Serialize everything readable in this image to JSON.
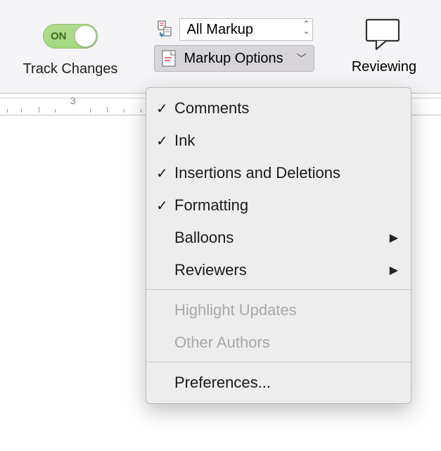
{
  "ribbon": {
    "track": {
      "label": "Track Changes",
      "toggle_state": "ON"
    },
    "display_select": {
      "value": "All Markup"
    },
    "markup_options": {
      "label": "Markup Options"
    },
    "reviewing": {
      "label": "Reviewing"
    }
  },
  "ruler": {
    "visible_number": "3"
  },
  "menu": {
    "items": [
      {
        "label": "Comments",
        "checked": true,
        "submenu": false,
        "disabled": false
      },
      {
        "label": "Ink",
        "checked": true,
        "submenu": false,
        "disabled": false
      },
      {
        "label": "Insertions and Deletions",
        "checked": true,
        "submenu": false,
        "disabled": false
      },
      {
        "label": "Formatting",
        "checked": true,
        "submenu": false,
        "disabled": false
      },
      {
        "label": "Balloons",
        "checked": false,
        "submenu": true,
        "disabled": false
      },
      {
        "label": "Reviewers",
        "checked": false,
        "submenu": true,
        "disabled": false
      }
    ],
    "disabled_items": [
      {
        "label": "Highlight Updates"
      },
      {
        "label": "Other Authors"
      }
    ],
    "footer": {
      "label": "Preferences..."
    }
  }
}
